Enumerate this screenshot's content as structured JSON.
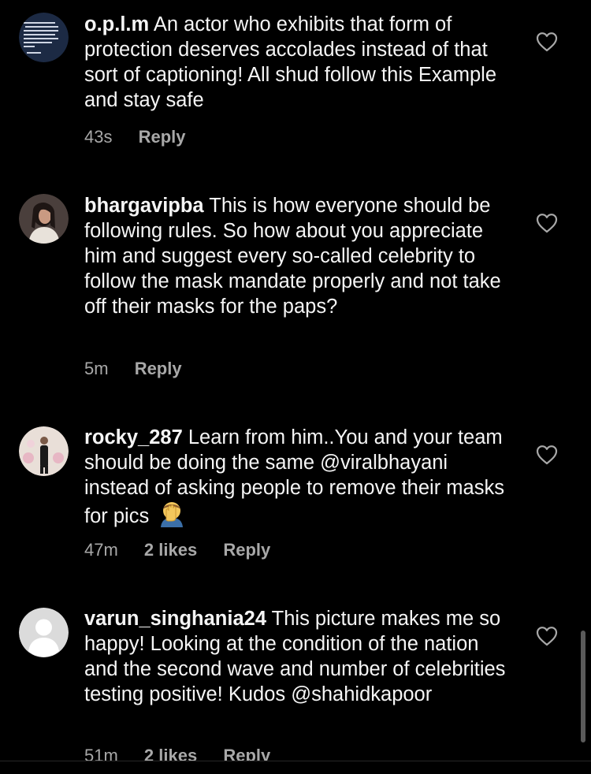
{
  "comments": [
    {
      "username": "o.p.l.m",
      "text": "An actor who exhibits that form of protection deserves accolades instead of that sort of captioning! All shud follow this Example and stay safe",
      "time": "43s",
      "likes": "",
      "reply_label": "Reply",
      "avatar_text": "n't broadcas, very high and I don't hide every love... I'm trying to live, not convince the world I have a life. \" yonce"
    },
    {
      "username": "bhargavipba",
      "text": "This is how everyone should be following rules. So how about you appreciate him and suggest every so-called celebrity to follow the mask mandate properly and not take off their masks for the paps?",
      "time": "5m",
      "likes": "",
      "reply_label": "Reply"
    },
    {
      "username": "rocky_287",
      "text": "Learn from him..You and your team should be doing the same @viralbhayani instead of asking people to remove their masks for pics",
      "emoji": "face-palm-emoji",
      "time": "47m",
      "likes": "2 likes",
      "reply_label": "Reply"
    },
    {
      "username": "varun_singhania24",
      "text": "This picture makes me so happy! Looking at the condition of the nation and the second wave and number of celebrities testing positive! Kudos @shahidkapoor",
      "time": "51m",
      "likes": "2 likes",
      "reply_label": "Reply"
    }
  ],
  "icons": {
    "like": "heart-outline-icon",
    "default_avatar": "default-avatar-icon"
  },
  "colors": {
    "background": "#000000",
    "primary_text": "#f5f5f5",
    "secondary_text": "#a8a8a8",
    "avatar_placeholder": "#dbdbdb"
  }
}
